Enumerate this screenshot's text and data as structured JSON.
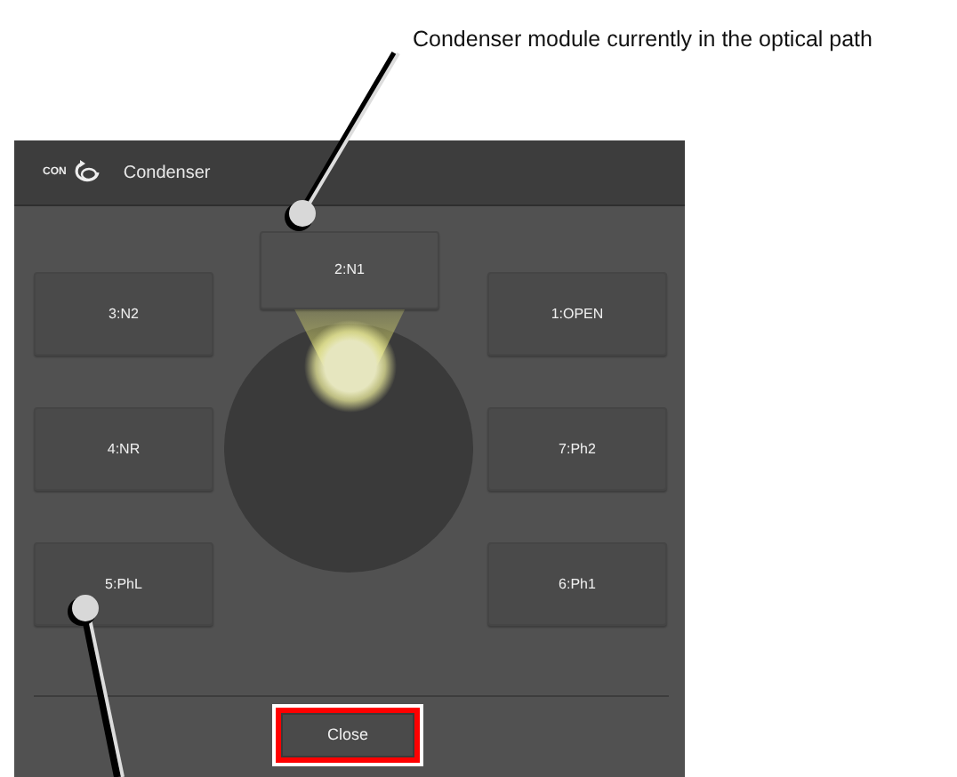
{
  "callouts": [
    {
      "kind": "top",
      "text": "Condenser module currently in the optical path"
    },
    {
      "kind": "bottom"
    }
  ],
  "dialog": {
    "logo_text": "CON",
    "title": "Condenser",
    "positions": [
      {
        "label": "2:N1",
        "selected": true
      },
      {
        "label": "3:N2",
        "selected": false
      },
      {
        "label": "1:OPEN",
        "selected": false
      },
      {
        "label": "4:NR",
        "selected": false
      },
      {
        "label": "7:Ph2",
        "selected": false
      },
      {
        "label": "5:PhL",
        "selected": false
      },
      {
        "label": "6:Ph1",
        "selected": false
      }
    ],
    "close_button": {
      "label": "Close",
      "highlighted": true
    }
  }
}
